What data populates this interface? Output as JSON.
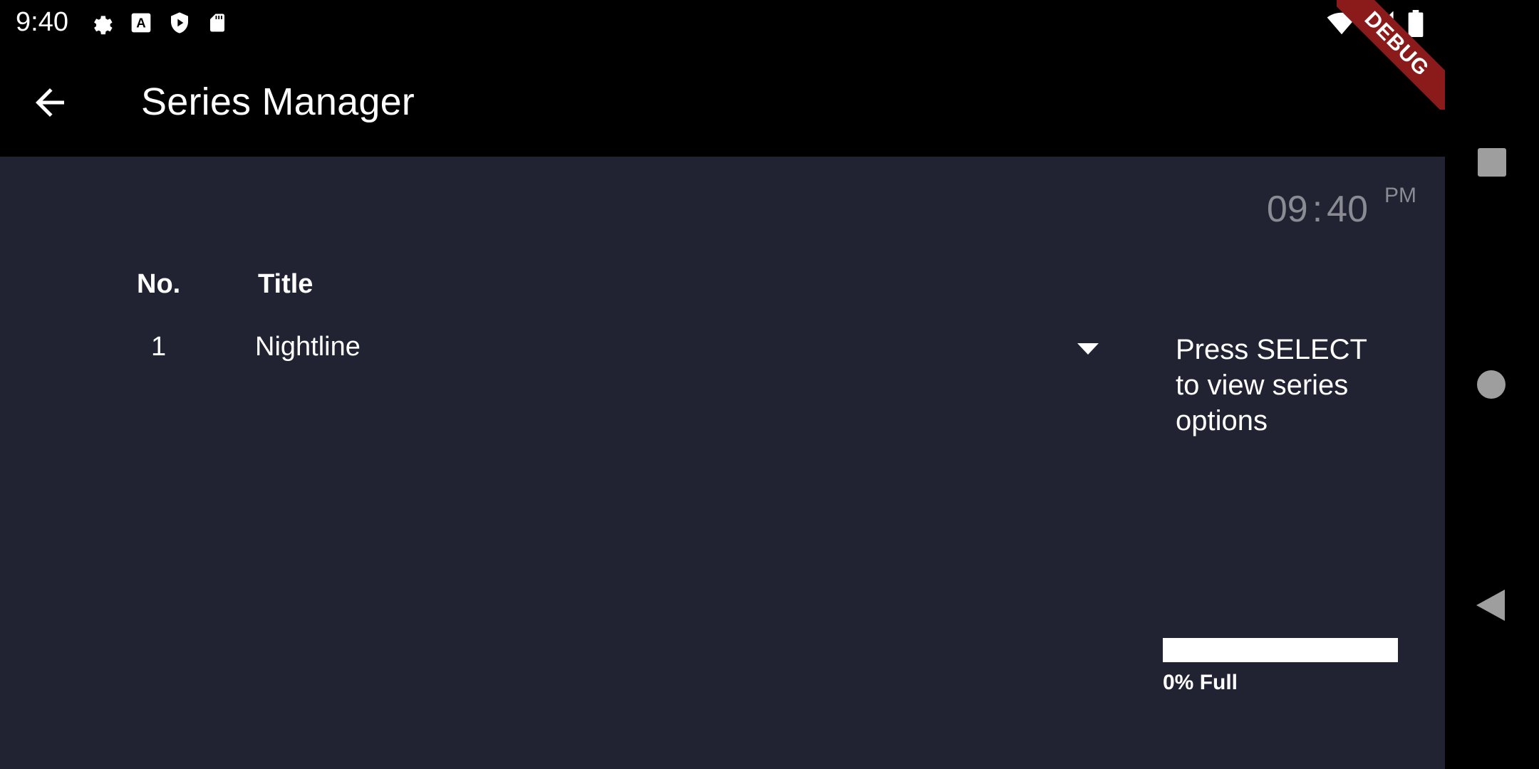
{
  "status_bar": {
    "time": "9:40",
    "icons": [
      "settings-icon",
      "font-icon",
      "play-shield-icon",
      "sd-card-icon"
    ],
    "right_icons": [
      "wifi-icon",
      "signal-icon",
      "battery-icon"
    ]
  },
  "app_bar": {
    "title": "Series Manager",
    "back_icon": "arrow-back-icon"
  },
  "debug_banner": "DEBUG",
  "clock": {
    "hours": "09",
    "minutes": "40",
    "ampm": "PM"
  },
  "table": {
    "headers": {
      "no": "No.",
      "title": "Title"
    },
    "rows": [
      {
        "no": "1",
        "title": "Nightline"
      }
    ]
  },
  "hint": "Press SELECT to view series options",
  "storage": {
    "fill_percent": 0,
    "label": "0% Full"
  },
  "nav_bar": {
    "buttons": [
      "recents-icon",
      "home-icon",
      "back-icon"
    ]
  },
  "colors": {
    "content_bg": "#212332",
    "app_bar_bg": "#000000",
    "clock_text": "#8a8b93",
    "debug_ribbon": "#8b1a1a"
  }
}
